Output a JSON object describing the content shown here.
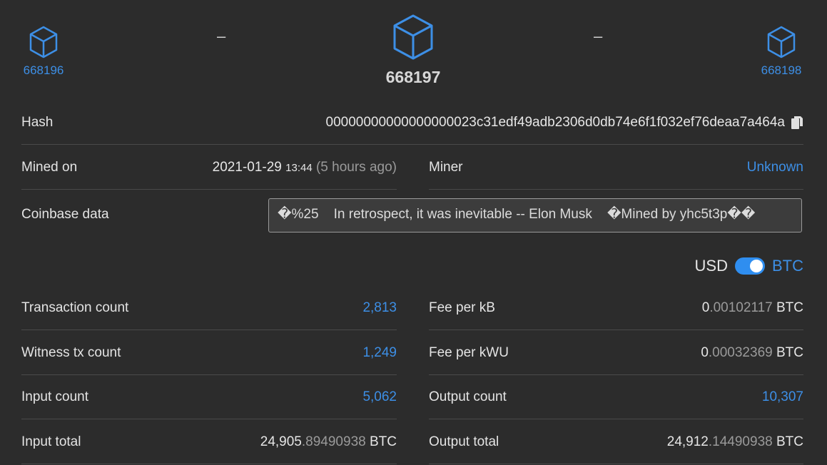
{
  "nav": {
    "prev_block": "668196",
    "current_block": "668197",
    "next_block": "668198",
    "separator": "–"
  },
  "hash": {
    "label": "Hash",
    "value": "00000000000000000023c31edf49adb2306d0db74e6f1f032ef76deaa7a464a"
  },
  "mined": {
    "label": "Mined on",
    "date": "2021-01-29",
    "time": "13:44",
    "relative": "(5 hours ago)"
  },
  "miner": {
    "label": "Miner",
    "value": "Unknown"
  },
  "coinbase": {
    "label": "Coinbase data",
    "value": "�%25    In retrospect, it was inevitable -- Elon Musk    �Mined by yhc5t3p��"
  },
  "currency_toggle": {
    "left": "USD",
    "right": "BTC",
    "selected": "BTC"
  },
  "stats_left": [
    {
      "label": "Transaction count",
      "value": "2,813"
    },
    {
      "label": "Witness tx count",
      "value": "1,249"
    },
    {
      "label": "Input count",
      "value": "5,062"
    },
    {
      "label": "Input total",
      "int": "24,905",
      "dec": ".89490938",
      "unit": " BTC"
    }
  ],
  "stats_right": [
    {
      "label": "Fee per kB",
      "int": "0",
      "dec": ".00102117",
      "unit": " BTC"
    },
    {
      "label": "Fee per kWU",
      "int": "0",
      "dec": ".00032369",
      "unit": " BTC"
    },
    {
      "label": "Output count",
      "value": "10,307"
    },
    {
      "label": "Output total",
      "int": "24,912",
      "dec": ".14490938",
      "unit": " BTC"
    }
  ],
  "colors": {
    "background": "#2c2c2c",
    "accent": "#3d8fe6",
    "divider": "#4a4a4a"
  },
  "icons": [
    "cube-icon",
    "copy-icon"
  ]
}
